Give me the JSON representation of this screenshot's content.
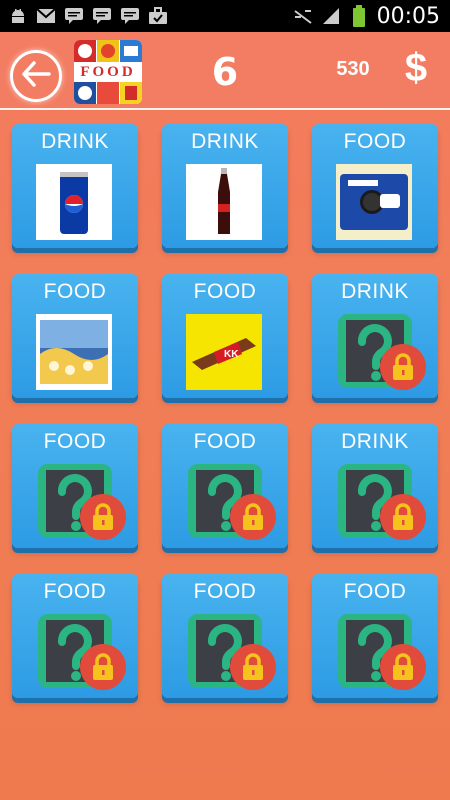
{
  "status_bar": {
    "time": "00:05",
    "icons": [
      "android-debug-icon",
      "gmail-icon",
      "chat-icon",
      "chat-icon",
      "chat-icon",
      "briefcase-icon",
      "signal-off-icon",
      "cell-signal-icon",
      "battery-icon"
    ]
  },
  "header": {
    "level": "6",
    "coins": "530",
    "currency_symbol": "$",
    "logo_text": "FOOD"
  },
  "tiles": [
    {
      "label": "DRINK",
      "state": "unlocked",
      "image": "pepsi-can"
    },
    {
      "label": "DRINK",
      "state": "unlocked",
      "image": "cola-bottle"
    },
    {
      "label": "FOOD",
      "state": "unlocked",
      "image": "oreo-pack"
    },
    {
      "label": "FOOD",
      "state": "unlocked",
      "image": "popcorn-box"
    },
    {
      "label": "FOOD",
      "state": "unlocked",
      "image": "kitkat-bar"
    },
    {
      "label": "DRINK",
      "state": "locked",
      "image": "question-mark"
    },
    {
      "label": "FOOD",
      "state": "locked",
      "image": "question-mark"
    },
    {
      "label": "FOOD",
      "state": "locked",
      "image": "question-mark"
    },
    {
      "label": "DRINK",
      "state": "locked",
      "image": "question-mark"
    },
    {
      "label": "FOOD",
      "state": "locked",
      "image": "question-mark"
    },
    {
      "label": "FOOD",
      "state": "locked",
      "image": "question-mark"
    },
    {
      "label": "FOOD",
      "state": "locked",
      "image": "question-mark"
    }
  ],
  "colors": {
    "background": "#f17e58",
    "tile": "#2d9be4",
    "locked_box": "#2ab583",
    "lock_badge": "#e14b3c",
    "lock": "#f6c21c"
  }
}
